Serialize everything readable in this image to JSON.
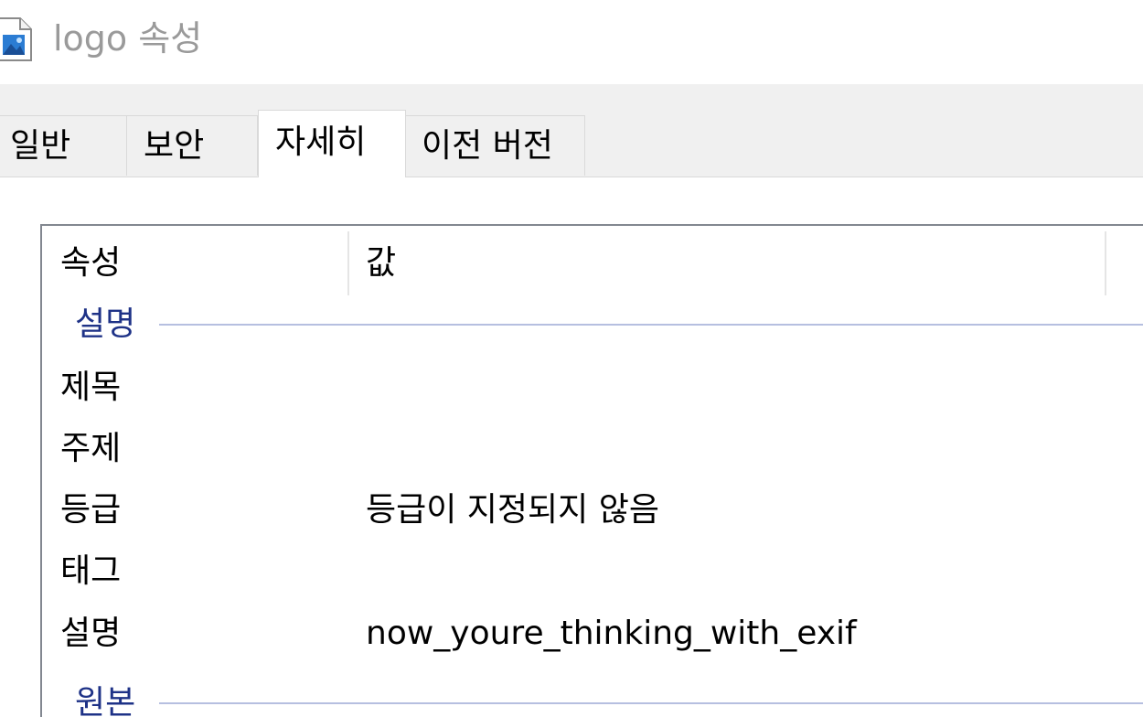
{
  "window": {
    "title": "logo 속성",
    "icon": "image-file-icon"
  },
  "tabs": [
    {
      "label": "일반",
      "active": false
    },
    {
      "label": "보안",
      "active": false
    },
    {
      "label": "자세히",
      "active": true
    },
    {
      "label": "이전 버전",
      "active": false
    }
  ],
  "details": {
    "columns": {
      "property": "속성",
      "value": "값"
    },
    "groups": [
      {
        "label": "설명",
        "rows": [
          {
            "name": "제목",
            "value": ""
          },
          {
            "name": "주제",
            "value": ""
          },
          {
            "name": "등급",
            "value": "등급이 지정되지 않음"
          },
          {
            "name": "태그",
            "value": ""
          },
          {
            "name": "설명",
            "value": "now_youre_thinking_with_exif"
          }
        ]
      },
      {
        "label": "원본",
        "rows": []
      }
    ]
  },
  "colors": {
    "group_text": "#1e3287",
    "group_line": "#b6bfe0",
    "title_text": "#9a9a9a",
    "tab_strip": "#f0f0f0"
  }
}
